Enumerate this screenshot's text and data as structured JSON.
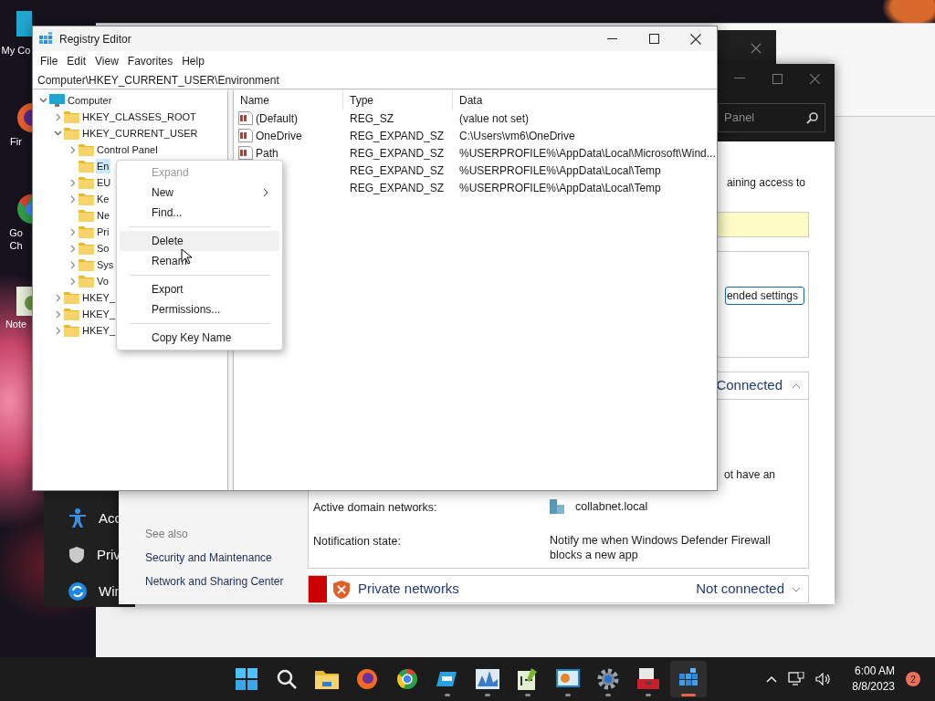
{
  "desktop": {
    "icons": [
      {
        "lines": [
          "My Co"
        ],
        "kind": "computer"
      },
      {
        "lines": [
          "Fir"
        ],
        "kind": "firefox"
      },
      {
        "lines": [
          "Go",
          "Ch"
        ],
        "kind": "chrome"
      },
      {
        "lines": [
          "Note"
        ],
        "kind": "notepad"
      }
    ]
  },
  "background_window": {
    "kind": "light"
  },
  "other_window": {
    "kind": "dark"
  },
  "settings_window": {
    "items": [
      {
        "label": "Acc",
        "kind": "accessibility"
      },
      {
        "label": "Priv",
        "kind": "privacy"
      },
      {
        "label": "Win",
        "kind": "update"
      }
    ]
  },
  "firewall_window": {
    "search": {
      "placeholder": "Panel"
    },
    "intro_fragment": "aining access to",
    "settings_button": "ended settings",
    "see_also": {
      "heading": "See also",
      "links": [
        "Security and Maintenance",
        "Network and Sharing Center"
      ]
    },
    "domain_networks": {
      "status": "Connected",
      "expanded": true,
      "text_fragment": "ot have an",
      "rows": [
        {
          "label": "Active domain networks:",
          "value": "collabnet.local",
          "kind": "network"
        },
        {
          "label": "Notification state:",
          "value": "Notify me when Windows Defender Firewall blocks a new app",
          "kind": "text"
        }
      ]
    },
    "private_networks": {
      "title": "Private networks",
      "status": "Not connected",
      "expanded": false
    }
  },
  "registry_editor": {
    "title": "Registry Editor",
    "menu": [
      "File",
      "Edit",
      "View",
      "Favorites",
      "Help"
    ],
    "address": "Computer\\HKEY_CURRENT_USER\\Environment",
    "tree": [
      {
        "label": "Computer",
        "kind": "computer",
        "expandable": true,
        "expanded": true,
        "selected": false,
        "children": [
          {
            "label": "HKEY_CLASSES_ROOT",
            "kind": "folder",
            "expandable": true,
            "expanded": false,
            "selected": false
          },
          {
            "label": "HKEY_CURRENT_USER",
            "kind": "folder",
            "expandable": true,
            "expanded": true,
            "selected": false,
            "children": [
              {
                "label": "Control Panel",
                "kind": "folder",
                "expandable": true,
                "expanded": false,
                "selected": false
              },
              {
                "label": "En",
                "kind": "folder",
                "expandable": false,
                "expanded": false,
                "selected": true
              },
              {
                "label": "EU",
                "kind": "folder",
                "expandable": true,
                "expanded": false,
                "selected": false
              },
              {
                "label": "Ke",
                "kind": "folder",
                "expandable": true,
                "expanded": false,
                "selected": false
              },
              {
                "label": "Ne",
                "kind": "folder",
                "expandable": false,
                "expanded": false,
                "selected": false
              },
              {
                "label": "Pri",
                "kind": "folder",
                "expandable": true,
                "expanded": false,
                "selected": false
              },
              {
                "label": "So",
                "kind": "folder",
                "expandable": true,
                "expanded": false,
                "selected": false
              },
              {
                "label": "Sys",
                "kind": "folder",
                "expandable": true,
                "expanded": false,
                "selected": false
              },
              {
                "label": "Vo",
                "kind": "folder",
                "expandable": true,
                "expanded": false,
                "selected": false
              }
            ]
          },
          {
            "label": "HKEY_",
            "kind": "folder",
            "expandable": true,
            "expanded": false,
            "selected": false
          },
          {
            "label": "HKEY_",
            "kind": "folder",
            "expandable": true,
            "expanded": false,
            "selected": false
          },
          {
            "label": "HKEY_",
            "kind": "folder",
            "expandable": true,
            "expanded": false,
            "selected": false
          }
        ]
      }
    ],
    "columns": [
      "Name",
      "Type",
      "Data"
    ],
    "values": [
      {
        "name": "(Default)",
        "type": "REG_SZ",
        "data": "(value not set)"
      },
      {
        "name": "OneDrive",
        "type": "REG_EXPAND_SZ",
        "data": "C:\\Users\\vm6\\OneDrive"
      },
      {
        "name": "Path",
        "type": "REG_EXPAND_SZ",
        "data": "%USERPROFILE%\\AppData\\Local\\Microsoft\\Wind..."
      },
      {
        "type": "REG_EXPAND_SZ",
        "data": "%USERPROFILE%\\AppData\\Local\\Temp"
      },
      {
        "type": "REG_EXPAND_SZ",
        "data": "%USERPROFILE%\\AppData\\Local\\Temp"
      }
    ]
  },
  "context_menu": [
    {
      "kind": "item",
      "label": "Expand",
      "disabled": true,
      "selected": false,
      "submenu": false
    },
    {
      "kind": "item",
      "label": "New",
      "disabled": false,
      "selected": false,
      "submenu": true
    },
    {
      "kind": "item",
      "label": "Find...",
      "disabled": false,
      "selected": false,
      "submenu": false
    },
    {
      "kind": "separator"
    },
    {
      "kind": "item",
      "label": "Delete",
      "disabled": false,
      "selected": true,
      "submenu": false
    },
    {
      "kind": "item",
      "label": "Renam",
      "disabled": false,
      "selected": false,
      "submenu": false
    },
    {
      "kind": "separator"
    },
    {
      "kind": "item",
      "label": "Export",
      "disabled": false,
      "selected": false,
      "submenu": false
    },
    {
      "kind": "item",
      "label": "Permissions...",
      "disabled": false,
      "selected": false,
      "submenu": false
    },
    {
      "kind": "separator"
    },
    {
      "kind": "item",
      "label": "Copy Key Name",
      "disabled": false,
      "selected": false,
      "submenu": false
    }
  ],
  "taskbar": {
    "apps": [
      {
        "kind": "start",
        "running": false,
        "selected": false
      },
      {
        "kind": "search",
        "running": false,
        "selected": false
      },
      {
        "kind": "folder",
        "running": false,
        "selected": false
      },
      {
        "kind": "firefox",
        "running": false,
        "selected": false
      },
      {
        "kind": "chrome",
        "running": false,
        "selected": false
      },
      {
        "kind": "drive",
        "running": true,
        "selected": false
      },
      {
        "kind": "chart",
        "running": true,
        "selected": false
      },
      {
        "kind": "notepad",
        "running": true,
        "selected": false
      },
      {
        "kind": "remote",
        "running": true,
        "selected": false
      },
      {
        "kind": "gear",
        "running": true,
        "selected": false
      },
      {
        "kind": "toolbox",
        "running": true,
        "selected": false
      },
      {
        "kind": "registry",
        "running": true,
        "selected": true
      }
    ],
    "time": "6:00 AM",
    "date": "8/8/2023",
    "notifications": "2"
  }
}
